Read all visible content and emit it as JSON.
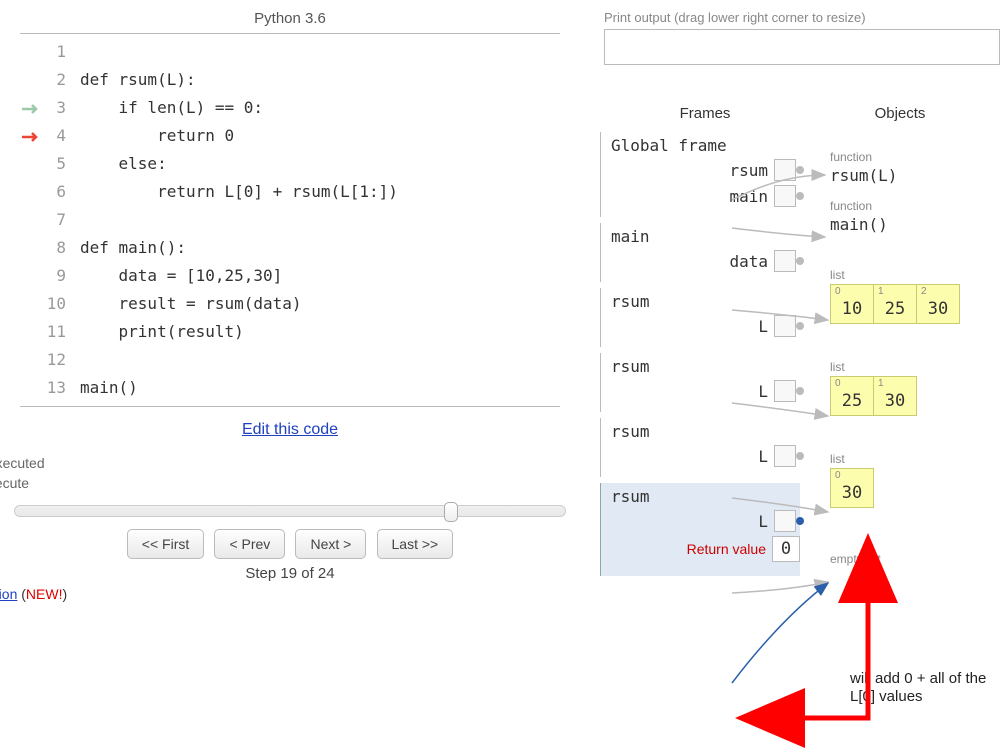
{
  "title": "Python 3.6",
  "code": [
    "",
    "def rsum(L):",
    "    if len(L) == 0:",
    "        return 0",
    "    else:",
    "        return L[0] + rsum(L[1:])",
    "",
    "def main():",
    "    data = [10,25,30]",
    "    result = rsum(data)",
    "    print(result)",
    "",
    "main()"
  ],
  "current_line_arrow": 4,
  "prev_line_arrow": 3,
  "edit_link": "Edit this code",
  "status1": "t executed",
  "status2": "execute",
  "buttons": {
    "first": "<< First",
    "prev": "< Prev",
    "next": "Next >",
    "last": "Last >>"
  },
  "step_label": "Step 19 of 24",
  "bottom_link_text": "zation",
  "bottom_new": "NEW!",
  "output_label": "Print output (drag lower right corner to resize)",
  "headers": {
    "frames": "Frames",
    "objects": "Objects"
  },
  "frames": [
    {
      "title": "Global frame",
      "vars": [
        "rsum",
        "main"
      ]
    },
    {
      "title": "main",
      "vars": [
        "data"
      ]
    },
    {
      "title": "rsum",
      "vars": [
        "L"
      ]
    },
    {
      "title": "rsum",
      "vars": [
        "L"
      ]
    },
    {
      "title": "rsum",
      "vars": [
        "L"
      ]
    },
    {
      "title": "rsum",
      "vars": [
        "L"
      ],
      "active": true,
      "return": "0",
      "return_label": "Return value"
    }
  ],
  "objects": {
    "fn1_label": "function",
    "fn1": "rsum(L)",
    "fn2_label": "function",
    "fn2": "main()",
    "list_label": "list",
    "list1": [
      "10",
      "25",
      "30"
    ],
    "list2": [
      "25",
      "30"
    ],
    "list3": [
      "30"
    ],
    "empty_label": "empty list"
  },
  "annotation": "will add 0 + all of the L[0] values"
}
